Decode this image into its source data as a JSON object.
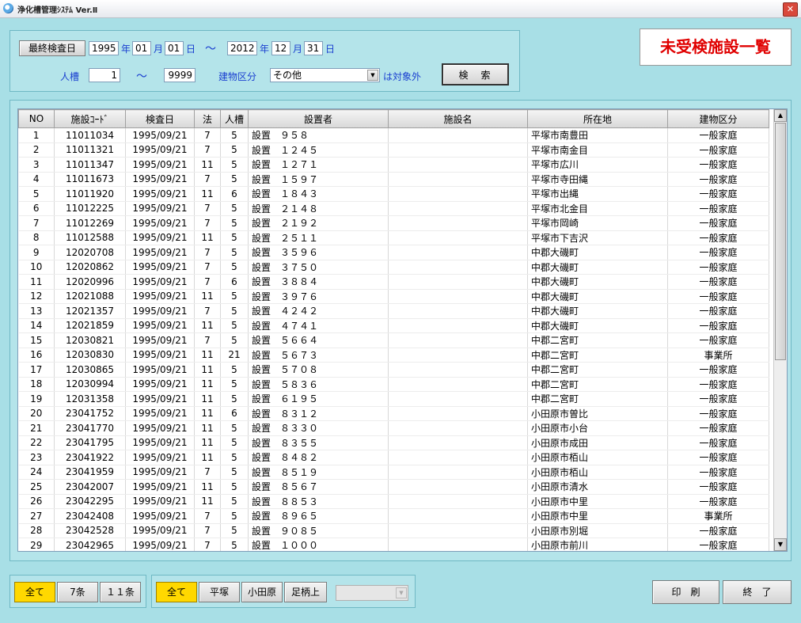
{
  "window": {
    "title": "浄化槽管理ｼｽﾃﾑ Ver.Ⅱ",
    "close_label": "✕"
  },
  "header": {
    "badge": "未受検施設一覧"
  },
  "filter": {
    "date_button": "最終検査日",
    "from_year": "1995",
    "from_month": "01",
    "from_day": "01",
    "to_year": "2012",
    "to_month": "12",
    "to_day": "31",
    "year_unit": "年",
    "month_unit": "月",
    "day_unit": "日",
    "tilde": "～",
    "person_label": "人槽",
    "person_from": "1",
    "person_to": "9999",
    "building_label": "建物区分",
    "building_value": "その他",
    "excluded_suffix": "は対象外",
    "search_button": "検　索"
  },
  "columns": [
    "NO",
    "施設ｺｰﾄﾞ",
    "検査日",
    "法",
    "人槽",
    "設置者",
    "施設名",
    "所在地",
    "建物区分"
  ],
  "rows": [
    [
      "1",
      "11011034",
      "1995/09/21",
      "7",
      "5",
      "設置　９５８",
      "",
      "平塚市南豊田",
      "一般家庭"
    ],
    [
      "2",
      "11011321",
      "1995/09/21",
      "7",
      "5",
      "設置　１２４５",
      "",
      "平塚市南金目",
      "一般家庭"
    ],
    [
      "3",
      "11011347",
      "1995/09/21",
      "11",
      "5",
      "設置　１２７１",
      "",
      "平塚市広川",
      "一般家庭"
    ],
    [
      "4",
      "11011673",
      "1995/09/21",
      "7",
      "5",
      "設置　１５９７",
      "",
      "平塚市寺田縄",
      "一般家庭"
    ],
    [
      "5",
      "11011920",
      "1995/09/21",
      "11",
      "6",
      "設置　１８４３",
      "",
      "平塚市出縄",
      "一般家庭"
    ],
    [
      "6",
      "11012225",
      "1995/09/21",
      "7",
      "5",
      "設置　２１４８",
      "",
      "平塚市北金目",
      "一般家庭"
    ],
    [
      "7",
      "11012269",
      "1995/09/21",
      "7",
      "5",
      "設置　２１９２",
      "",
      "平塚市岡崎",
      "一般家庭"
    ],
    [
      "8",
      "11012588",
      "1995/09/21",
      "11",
      "5",
      "設置　２５１１",
      "",
      "平塚市下吉沢",
      "一般家庭"
    ],
    [
      "9",
      "12020708",
      "1995/09/21",
      "7",
      "5",
      "設置　３５９６",
      "",
      "中郡大磯町",
      "一般家庭"
    ],
    [
      "10",
      "12020862",
      "1995/09/21",
      "7",
      "5",
      "設置　３７５０",
      "",
      "中郡大磯町",
      "一般家庭"
    ],
    [
      "11",
      "12020996",
      "1995/09/21",
      "7",
      "6",
      "設置　３８８４",
      "",
      "中郡大磯町",
      "一般家庭"
    ],
    [
      "12",
      "12021088",
      "1995/09/21",
      "11",
      "5",
      "設置　３９７６",
      "",
      "中郡大磯町",
      "一般家庭"
    ],
    [
      "13",
      "12021357",
      "1995/09/21",
      "7",
      "5",
      "設置　４２４２",
      "",
      "中郡大磯町",
      "一般家庭"
    ],
    [
      "14",
      "12021859",
      "1995/09/21",
      "11",
      "5",
      "設置　４７４１",
      "",
      "中郡大磯町",
      "一般家庭"
    ],
    [
      "15",
      "12030821",
      "1995/09/21",
      "7",
      "5",
      "設置　５６６４",
      "",
      "中郡二宮町",
      "一般家庭"
    ],
    [
      "16",
      "12030830",
      "1995/09/21",
      "11",
      "21",
      "設置　５６７３",
      "",
      "中郡二宮町",
      "事業所"
    ],
    [
      "17",
      "12030865",
      "1995/09/21",
      "11",
      "5",
      "設置　５７０８",
      "",
      "中郡二宮町",
      "一般家庭"
    ],
    [
      "18",
      "12030994",
      "1995/09/21",
      "11",
      "5",
      "設置　５８３６",
      "",
      "中郡二宮町",
      "一般家庭"
    ],
    [
      "19",
      "12031358",
      "1995/09/21",
      "11",
      "5",
      "設置　６１９５",
      "",
      "中郡二宮町",
      "一般家庭"
    ],
    [
      "20",
      "23041752",
      "1995/09/21",
      "11",
      "6",
      "設置　８３１２",
      "",
      "小田原市曽比",
      "一般家庭"
    ],
    [
      "21",
      "23041770",
      "1995/09/21",
      "11",
      "5",
      "設置　８３３０",
      "",
      "小田原市小台",
      "一般家庭"
    ],
    [
      "22",
      "23041795",
      "1995/09/21",
      "11",
      "5",
      "設置　８３５５",
      "",
      "小田原市成田",
      "一般家庭"
    ],
    [
      "23",
      "23041922",
      "1995/09/21",
      "11",
      "5",
      "設置　８４８２",
      "",
      "小田原市栢山",
      "一般家庭"
    ],
    [
      "24",
      "23041959",
      "1995/09/21",
      "7",
      "5",
      "設置　８５１９",
      "",
      "小田原市栢山",
      "一般家庭"
    ],
    [
      "25",
      "23042007",
      "1995/09/21",
      "11",
      "5",
      "設置　８５６７",
      "",
      "小田原市清水",
      "一般家庭"
    ],
    [
      "26",
      "23042295",
      "1995/09/21",
      "11",
      "5",
      "設置　８８５３",
      "",
      "小田原市中里",
      "一般家庭"
    ],
    [
      "27",
      "23042408",
      "1995/09/21",
      "7",
      "5",
      "設置　８９６５",
      "",
      "小田原市中里",
      "事業所"
    ],
    [
      "28",
      "23042528",
      "1995/09/21",
      "7",
      "5",
      "設置　９０８５",
      "",
      "小田原市別堀",
      "一般家庭"
    ],
    [
      "29",
      "23042965",
      "1995/09/21",
      "7",
      "5",
      "設置　１０００",
      "",
      "小田原市前川",
      "一般家庭"
    ]
  ],
  "law_filter": [
    "全て",
    "7条",
    "１１条"
  ],
  "area_filter": [
    "全て",
    "平塚",
    "小田原",
    "足柄上"
  ],
  "actions": {
    "print": "印　刷",
    "close": "終　了"
  },
  "colors": {
    "background": "#a8dfe6",
    "active_toggle": "#ffd800",
    "label_blue": "#1a3fd0",
    "badge_red": "#e00000"
  }
}
